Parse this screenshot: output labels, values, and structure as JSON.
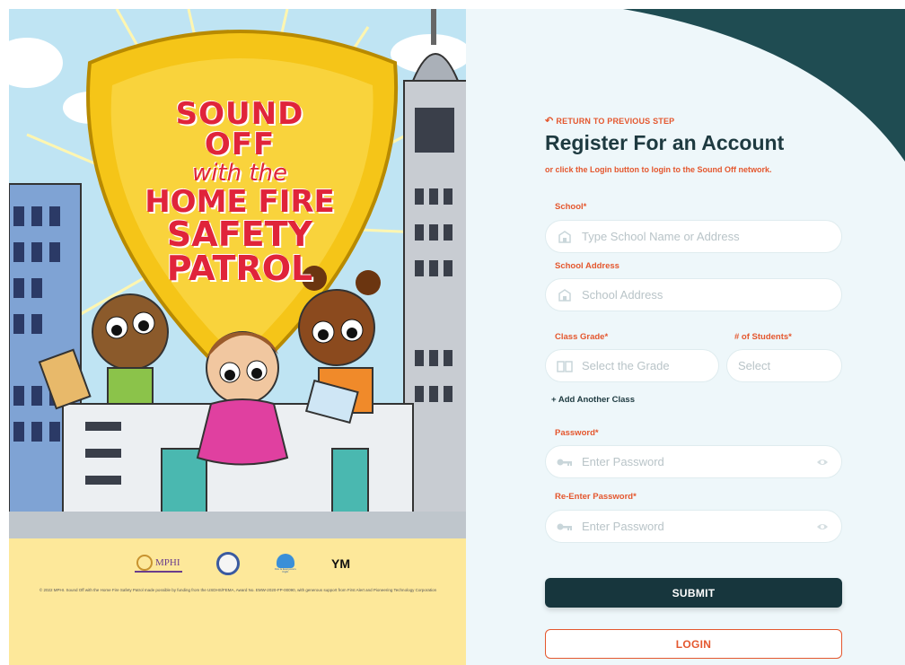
{
  "poster": {
    "title_line1": "SOUND OFF",
    "title_line2": "with the",
    "title_line3": "HOME FIRE",
    "title_line4": "SAFETY",
    "title_line5": "PATROL",
    "logo_mphi": "MPHI",
    "logo_fire_text": "Fire is Everyone's Fight",
    "logo_ym": "YM",
    "credit": "© 2022 MPHI. Sound Off with the Home Fire Safety Patrol made possible by funding from the USDHS/FEMA, Award No. EMW-2020-FP-00090, with generous support from First Alert and Pioneering Technology Corporation"
  },
  "form": {
    "back_link": "RETURN TO PREVIOUS STEP",
    "title": "Register For an Account",
    "subtitle": "or click the Login button to login to the Sound Off network.",
    "school_label": "School*",
    "school_placeholder": "Type School Name or Address",
    "school_address_label": "School Address",
    "school_address_placeholder": "School Address",
    "class_grade_label": "Class Grade*",
    "class_grade_placeholder": "Select the Grade",
    "students_label": "# of Students*",
    "students_placeholder": "Select",
    "add_class": "+ Add Another Class",
    "password_label": "Password*",
    "password_placeholder": "Enter Password",
    "reenter_label": "Re-Enter Password*",
    "reenter_placeholder": "Enter Password",
    "submit_label": "SUBMIT",
    "login_label": "LOGIN"
  },
  "colors": {
    "accent": "#e4572e",
    "dark": "#17363d",
    "panel_bg": "#eef7fa",
    "poster_yellow": "#fde89a"
  }
}
